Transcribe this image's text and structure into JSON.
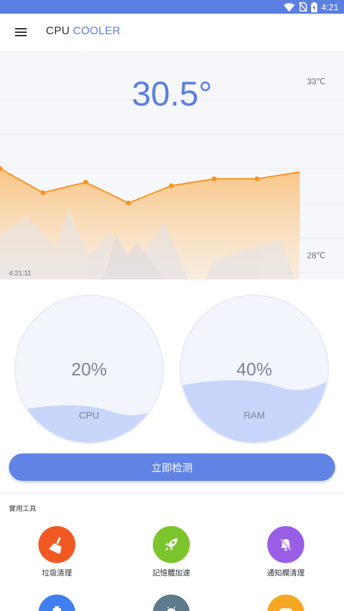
{
  "status_bar": {
    "time": "4:21"
  },
  "app_bar": {
    "title_part1": "CPU",
    "title_part2": "COOLER"
  },
  "temperature": {
    "current": "30.5°",
    "max_label": "33℃",
    "min_label": "28℃",
    "time_label": "4:21:11"
  },
  "chart_data": {
    "type": "area",
    "ylim": [
      28,
      33
    ],
    "values": [
      30.5,
      29.8,
      30.1,
      29.5,
      30.0,
      30.2,
      30.2,
      30.4
    ],
    "colors": {
      "line": "#f7931e",
      "fill_top": "#f9c585",
      "fill_bottom": "#fbe7cf"
    }
  },
  "gauges": [
    {
      "label": "CPU",
      "percent_text": "20%",
      "fill_fraction": 0.2
    },
    {
      "label": "RAM",
      "percent_text": "40%",
      "fill_fraction": 0.4
    }
  ],
  "detect_button": {
    "label": "立即检测"
  },
  "tools": {
    "title": "實用工具",
    "items": [
      {
        "label": "垃圾清理",
        "icon": "broom-icon",
        "color": "#f05a22"
      },
      {
        "label": "記憶體加速",
        "icon": "rocket-icon",
        "color": "#7bc42c"
      },
      {
        "label": "通知欄清理",
        "icon": "bell-off-icon",
        "color": "#9a5ee6"
      },
      {
        "label": "",
        "icon": "battery-icon",
        "color": "#3f7ff0"
      },
      {
        "label": "",
        "icon": "android-icon",
        "color": "#5f7a8c"
      },
      {
        "label": "",
        "icon": "game-icon",
        "color": "#f5a623"
      }
    ]
  },
  "colors": {
    "accent": "#5b7fe0",
    "button": "#6283e6",
    "wave": "#c8d6fb"
  }
}
